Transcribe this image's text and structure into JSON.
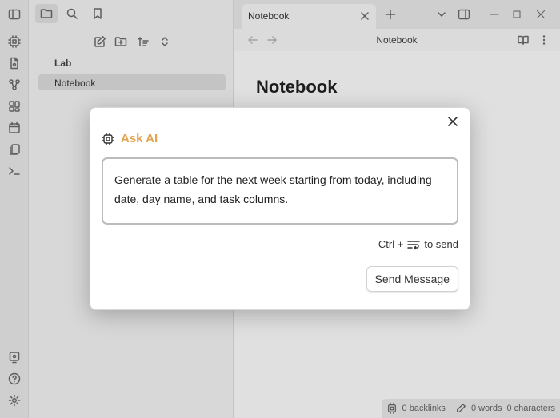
{
  "sidebar": {
    "folder_name": "Lab",
    "active_file": "Notebook"
  },
  "tab": {
    "title": "Notebook"
  },
  "view_header": {
    "title": "Notebook"
  },
  "note": {
    "title": "Notebook"
  },
  "status_bar": {
    "backlinks": "0 backlinks",
    "words": "0 words",
    "characters": "0 characters"
  },
  "modal": {
    "title": "Ask AI",
    "prompt": "Generate a table for the next week starting from today, including date, day name, and task columns.",
    "hint_prefix": "Ctrl +",
    "hint_suffix": "to send",
    "send_label": "Send Message"
  },
  "colors": {
    "accent": "#e2a54d",
    "modal_bg": "#ffffff",
    "sidebar_bg": "#f6f6f6"
  }
}
